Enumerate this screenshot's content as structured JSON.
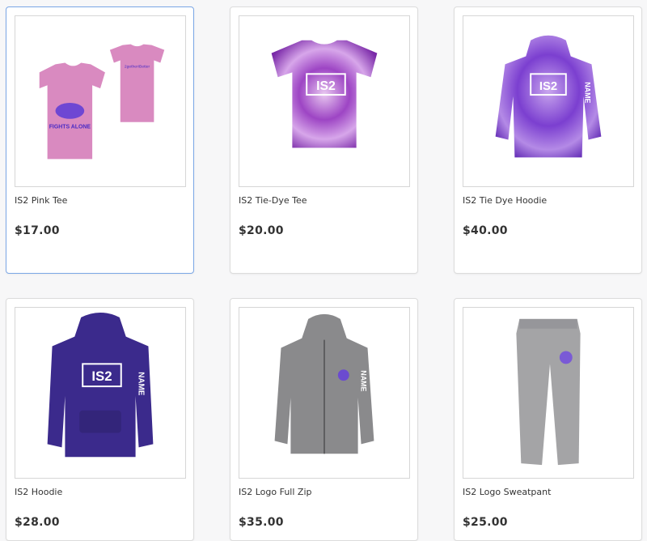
{
  "products": [
    {
      "name": "IS2 Pink Tee",
      "price": "$17.00",
      "image": "pink-tee-icon",
      "back_print": "2getherIBetter",
      "front_print": "FIGHTS ALONE"
    },
    {
      "name": "IS2 Tie-Dye Tee",
      "price": "$20.00",
      "image": "tie-dye-tee-icon",
      "logo": "IS2"
    },
    {
      "name": "IS2 Tie Dye Hoodie",
      "price": "$40.00",
      "image": "tie-dye-hoodie-icon",
      "logo": "IS2",
      "sleeve": "NAME"
    },
    {
      "name": "IS2 Hoodie",
      "price": "$28.00",
      "image": "purple-hoodie-icon",
      "logo": "IS2",
      "sleeve": "NAME"
    },
    {
      "name": "IS2 Logo Full Zip",
      "price": "$35.00",
      "image": "gray-zip-hoodie-icon",
      "sleeve": "NAME"
    },
    {
      "name": "IS2 Logo Sweatpant",
      "price": "$25.00",
      "image": "gray-sweatpant-icon"
    }
  ],
  "colors": {
    "selected_border": "#7ba7e6",
    "text": "#333333",
    "page_bg": "#f7f7f8"
  }
}
